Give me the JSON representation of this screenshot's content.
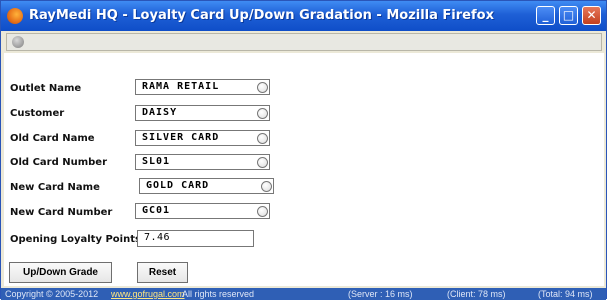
{
  "window": {
    "title": "RayMedi HQ - Loyalty Card Up/Down Gradation - Mozilla Firefox",
    "controls": {
      "minimize": "_",
      "maximize": "□",
      "close": "✕"
    }
  },
  "form": {
    "fields": [
      {
        "label": "Outlet Name",
        "value": "RAMA  RETAIL"
      },
      {
        "label": "Customer",
        "value": "DAISY"
      },
      {
        "label": "Old Card Name",
        "value": "SILVER CARD"
      },
      {
        "label": "Old Card Number",
        "value": "SL01"
      },
      {
        "label": "New Card Name",
        "value": "GOLD CARD"
      },
      {
        "label": "New Card Number",
        "value": "GC01"
      },
      {
        "label": "Opening Loyalty Points",
        "value": "7.46"
      }
    ],
    "buttons": {
      "grade": "Up/Down Grade",
      "reset": "Reset"
    }
  },
  "status": {
    "copyright": "Copyright © 2005-2012",
    "link": "www.gofrugal.com",
    "rights": "All rights reserved",
    "server": "(Server : 16 ms)",
    "client": "(Client: 78 ms)",
    "total": "(Total: 94 ms)"
  }
}
